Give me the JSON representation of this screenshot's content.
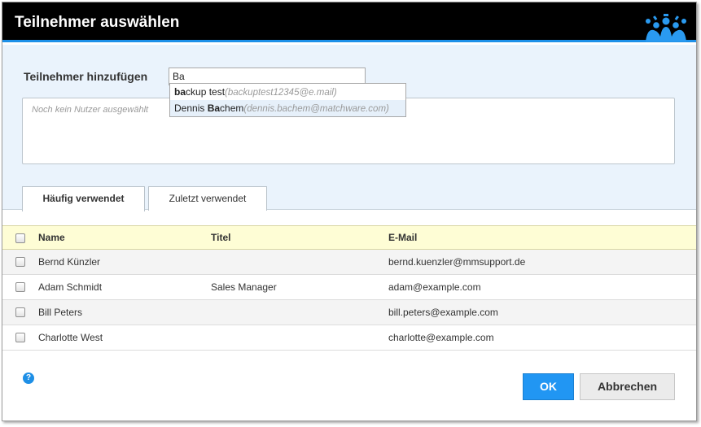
{
  "dialog": {
    "title": "Teilnehmer auswählen"
  },
  "add_participant": {
    "label": "Teilnehmer hinzufügen",
    "search_value": "Ba",
    "selected_placeholder": "Noch kein Nutzer ausgewählt"
  },
  "suggestions": [
    {
      "match": "ba",
      "rest_before": "",
      "rest_after": "ckup test",
      "email": "(backuptest12345@e.mail)"
    },
    {
      "match": "Ba",
      "rest_before": "Dennis ",
      "rest_after": "chem",
      "email": "(dennis.bachem@matchware.com)"
    }
  ],
  "tabs": [
    {
      "label": "Häufig verwendet",
      "active": true
    },
    {
      "label": "Zuletzt verwendet",
      "active": false
    }
  ],
  "table": {
    "columns": [
      "Name",
      "Titel",
      "E-Mail"
    ],
    "rows": [
      {
        "name": "Bernd Künzler",
        "title": "",
        "email": "bernd.kuenzler@mmsupport.de"
      },
      {
        "name": "Adam Schmidt",
        "title": "Sales Manager",
        "email": "adam@example.com"
      },
      {
        "name": "Bill Peters",
        "title": "",
        "email": "bill.peters@example.com"
      },
      {
        "name": "Charlotte West",
        "title": "",
        "email": "charlotte@example.com"
      }
    ]
  },
  "footer": {
    "help_glyph": "?",
    "ok_label": "OK",
    "cancel_label": "Abbrechen"
  },
  "colors": {
    "titlebar": "#000000",
    "accent": "#1e90e8",
    "header_row": "#fefdd5",
    "top_area": "#eaf3fc"
  },
  "icons": {
    "logo": "crown-people-logo",
    "help": "help-icon"
  }
}
